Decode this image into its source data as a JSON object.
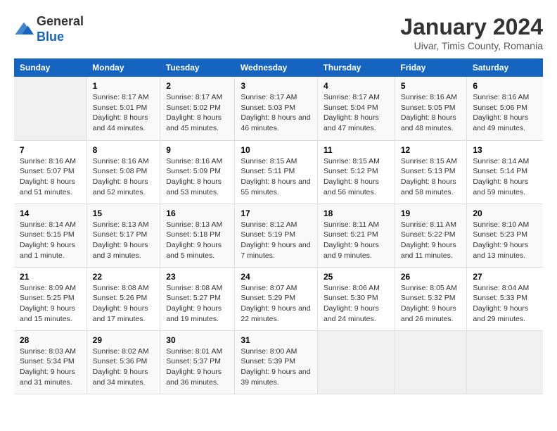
{
  "logo": {
    "general": "General",
    "blue": "Blue"
  },
  "title": "January 2024",
  "subtitle": "Uivar, Timis County, Romania",
  "weekdays": [
    "Sunday",
    "Monday",
    "Tuesday",
    "Wednesday",
    "Thursday",
    "Friday",
    "Saturday"
  ],
  "weeks": [
    [
      {
        "day": "",
        "sunrise": "",
        "sunset": "",
        "daylight": ""
      },
      {
        "day": "1",
        "sunrise": "Sunrise: 8:17 AM",
        "sunset": "Sunset: 5:01 PM",
        "daylight": "Daylight: 8 hours and 44 minutes."
      },
      {
        "day": "2",
        "sunrise": "Sunrise: 8:17 AM",
        "sunset": "Sunset: 5:02 PM",
        "daylight": "Daylight: 8 hours and 45 minutes."
      },
      {
        "day": "3",
        "sunrise": "Sunrise: 8:17 AM",
        "sunset": "Sunset: 5:03 PM",
        "daylight": "Daylight: 8 hours and 46 minutes."
      },
      {
        "day": "4",
        "sunrise": "Sunrise: 8:17 AM",
        "sunset": "Sunset: 5:04 PM",
        "daylight": "Daylight: 8 hours and 47 minutes."
      },
      {
        "day": "5",
        "sunrise": "Sunrise: 8:16 AM",
        "sunset": "Sunset: 5:05 PM",
        "daylight": "Daylight: 8 hours and 48 minutes."
      },
      {
        "day": "6",
        "sunrise": "Sunrise: 8:16 AM",
        "sunset": "Sunset: 5:06 PM",
        "daylight": "Daylight: 8 hours and 49 minutes."
      }
    ],
    [
      {
        "day": "7",
        "sunrise": "Sunrise: 8:16 AM",
        "sunset": "Sunset: 5:07 PM",
        "daylight": "Daylight: 8 hours and 51 minutes."
      },
      {
        "day": "8",
        "sunrise": "Sunrise: 8:16 AM",
        "sunset": "Sunset: 5:08 PM",
        "daylight": "Daylight: 8 hours and 52 minutes."
      },
      {
        "day": "9",
        "sunrise": "Sunrise: 8:16 AM",
        "sunset": "Sunset: 5:09 PM",
        "daylight": "Daylight: 8 hours and 53 minutes."
      },
      {
        "day": "10",
        "sunrise": "Sunrise: 8:15 AM",
        "sunset": "Sunset: 5:11 PM",
        "daylight": "Daylight: 8 hours and 55 minutes."
      },
      {
        "day": "11",
        "sunrise": "Sunrise: 8:15 AM",
        "sunset": "Sunset: 5:12 PM",
        "daylight": "Daylight: 8 hours and 56 minutes."
      },
      {
        "day": "12",
        "sunrise": "Sunrise: 8:15 AM",
        "sunset": "Sunset: 5:13 PM",
        "daylight": "Daylight: 8 hours and 58 minutes."
      },
      {
        "day": "13",
        "sunrise": "Sunrise: 8:14 AM",
        "sunset": "Sunset: 5:14 PM",
        "daylight": "Daylight: 8 hours and 59 minutes."
      }
    ],
    [
      {
        "day": "14",
        "sunrise": "Sunrise: 8:14 AM",
        "sunset": "Sunset: 5:15 PM",
        "daylight": "Daylight: 9 hours and 1 minute."
      },
      {
        "day": "15",
        "sunrise": "Sunrise: 8:13 AM",
        "sunset": "Sunset: 5:17 PM",
        "daylight": "Daylight: 9 hours and 3 minutes."
      },
      {
        "day": "16",
        "sunrise": "Sunrise: 8:13 AM",
        "sunset": "Sunset: 5:18 PM",
        "daylight": "Daylight: 9 hours and 5 minutes."
      },
      {
        "day": "17",
        "sunrise": "Sunrise: 8:12 AM",
        "sunset": "Sunset: 5:19 PM",
        "daylight": "Daylight: 9 hours and 7 minutes."
      },
      {
        "day": "18",
        "sunrise": "Sunrise: 8:11 AM",
        "sunset": "Sunset: 5:21 PM",
        "daylight": "Daylight: 9 hours and 9 minutes."
      },
      {
        "day": "19",
        "sunrise": "Sunrise: 8:11 AM",
        "sunset": "Sunset: 5:22 PM",
        "daylight": "Daylight: 9 hours and 11 minutes."
      },
      {
        "day": "20",
        "sunrise": "Sunrise: 8:10 AM",
        "sunset": "Sunset: 5:23 PM",
        "daylight": "Daylight: 9 hours and 13 minutes."
      }
    ],
    [
      {
        "day": "21",
        "sunrise": "Sunrise: 8:09 AM",
        "sunset": "Sunset: 5:25 PM",
        "daylight": "Daylight: 9 hours and 15 minutes."
      },
      {
        "day": "22",
        "sunrise": "Sunrise: 8:08 AM",
        "sunset": "Sunset: 5:26 PM",
        "daylight": "Daylight: 9 hours and 17 minutes."
      },
      {
        "day": "23",
        "sunrise": "Sunrise: 8:08 AM",
        "sunset": "Sunset: 5:27 PM",
        "daylight": "Daylight: 9 hours and 19 minutes."
      },
      {
        "day": "24",
        "sunrise": "Sunrise: 8:07 AM",
        "sunset": "Sunset: 5:29 PM",
        "daylight": "Daylight: 9 hours and 22 minutes."
      },
      {
        "day": "25",
        "sunrise": "Sunrise: 8:06 AM",
        "sunset": "Sunset: 5:30 PM",
        "daylight": "Daylight: 9 hours and 24 minutes."
      },
      {
        "day": "26",
        "sunrise": "Sunrise: 8:05 AM",
        "sunset": "Sunset: 5:32 PM",
        "daylight": "Daylight: 9 hours and 26 minutes."
      },
      {
        "day": "27",
        "sunrise": "Sunrise: 8:04 AM",
        "sunset": "Sunset: 5:33 PM",
        "daylight": "Daylight: 9 hours and 29 minutes."
      }
    ],
    [
      {
        "day": "28",
        "sunrise": "Sunrise: 8:03 AM",
        "sunset": "Sunset: 5:34 PM",
        "daylight": "Daylight: 9 hours and 31 minutes."
      },
      {
        "day": "29",
        "sunrise": "Sunrise: 8:02 AM",
        "sunset": "Sunset: 5:36 PM",
        "daylight": "Daylight: 9 hours and 34 minutes."
      },
      {
        "day": "30",
        "sunrise": "Sunrise: 8:01 AM",
        "sunset": "Sunset: 5:37 PM",
        "daylight": "Daylight: 9 hours and 36 minutes."
      },
      {
        "day": "31",
        "sunrise": "Sunrise: 8:00 AM",
        "sunset": "Sunset: 5:39 PM",
        "daylight": "Daylight: 9 hours and 39 minutes."
      },
      {
        "day": "",
        "sunrise": "",
        "sunset": "",
        "daylight": ""
      },
      {
        "day": "",
        "sunrise": "",
        "sunset": "",
        "daylight": ""
      },
      {
        "day": "",
        "sunrise": "",
        "sunset": "",
        "daylight": ""
      }
    ]
  ]
}
